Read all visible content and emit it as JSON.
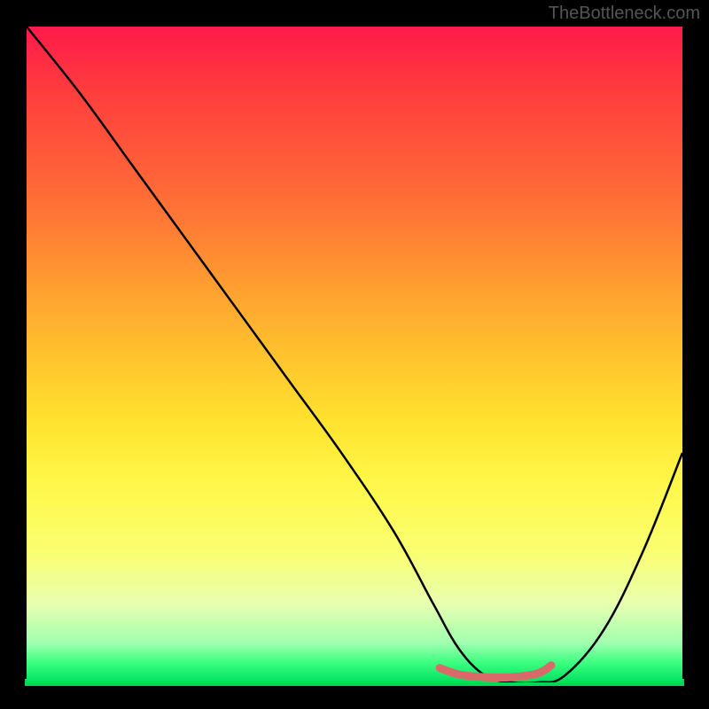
{
  "watermark": "TheBottleneck.com",
  "chart_data": {
    "type": "line",
    "title": "",
    "xlabel": "",
    "ylabel": "",
    "xlim": [
      0,
      100
    ],
    "ylim": [
      0,
      100
    ],
    "series": [
      {
        "name": "bottleneck-curve",
        "x": [
          0,
          8,
          16,
          24,
          32,
          40,
          48,
          56,
          62,
          66,
          70,
          74,
          78,
          82,
          88,
          94,
          100
        ],
        "y": [
          100,
          90,
          79,
          68,
          57,
          46,
          35,
          23,
          12,
          5,
          1,
          0,
          0,
          1,
          8,
          20,
          35
        ]
      },
      {
        "name": "flat-bottom-highlight",
        "x": [
          63,
          66,
          70,
          74,
          78,
          80
        ],
        "y": [
          2.2,
          1.2,
          0.8,
          0.8,
          1.4,
          2.6
        ]
      }
    ],
    "colors": {
      "curve": "#000000",
      "highlight": "#d86a6a",
      "gradient_top": "#ff1a4a",
      "gradient_bottom": "#00e060"
    }
  }
}
